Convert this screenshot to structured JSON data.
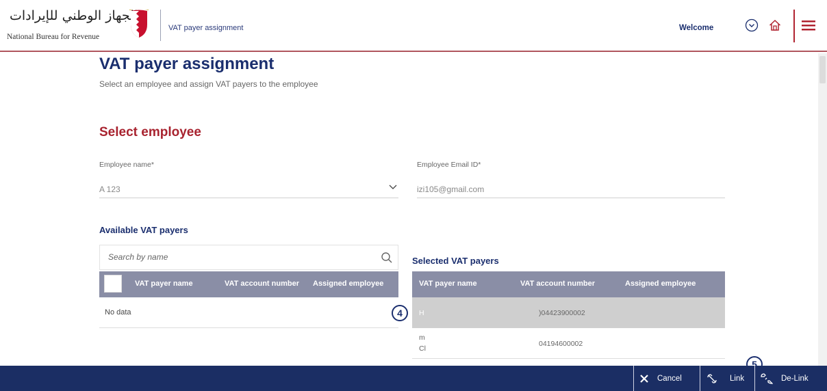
{
  "header": {
    "logo_arabic": "الجهاز الوطني للإيرادات",
    "logo_english": "National Bureau for Revenue",
    "title": "VAT payer assignment",
    "welcome": "Welcome"
  },
  "page": {
    "title": "VAT payer assignment",
    "subtitle": "Select an employee and assign VAT payers to the employee"
  },
  "select_employee": {
    "title": "Select employee",
    "name_label": "Employee name*",
    "name_value": "A 123",
    "email_label": "Employee Email ID*",
    "email_value": "izi105@gmail.com"
  },
  "available": {
    "title": "Available VAT payers",
    "search_placeholder": "Search by name",
    "columns": [
      "VAT payer name",
      "VAT account number",
      "Assigned employee"
    ],
    "empty_text": "No data"
  },
  "selected": {
    "title": "Selected VAT payers",
    "columns": [
      "VAT payer name",
      "VAT account number",
      "Assigned employee"
    ],
    "rows": [
      {
        "name": "H",
        "account": ")04423900002",
        "assigned": ""
      },
      {
        "name": "m",
        "name2": "Cl",
        "account": "04194600002",
        "assigned": ""
      }
    ]
  },
  "annotations": {
    "badge_4": "4",
    "badge_5": "5"
  },
  "footer": {
    "cancel": "Cancel",
    "link": "Link",
    "delink": "De-Link"
  },
  "colors": {
    "navy": "#1b2e64",
    "brand_red": "#a8232f",
    "table_header": "#8a8ea6",
    "selected_row": "#cfcfcf"
  }
}
